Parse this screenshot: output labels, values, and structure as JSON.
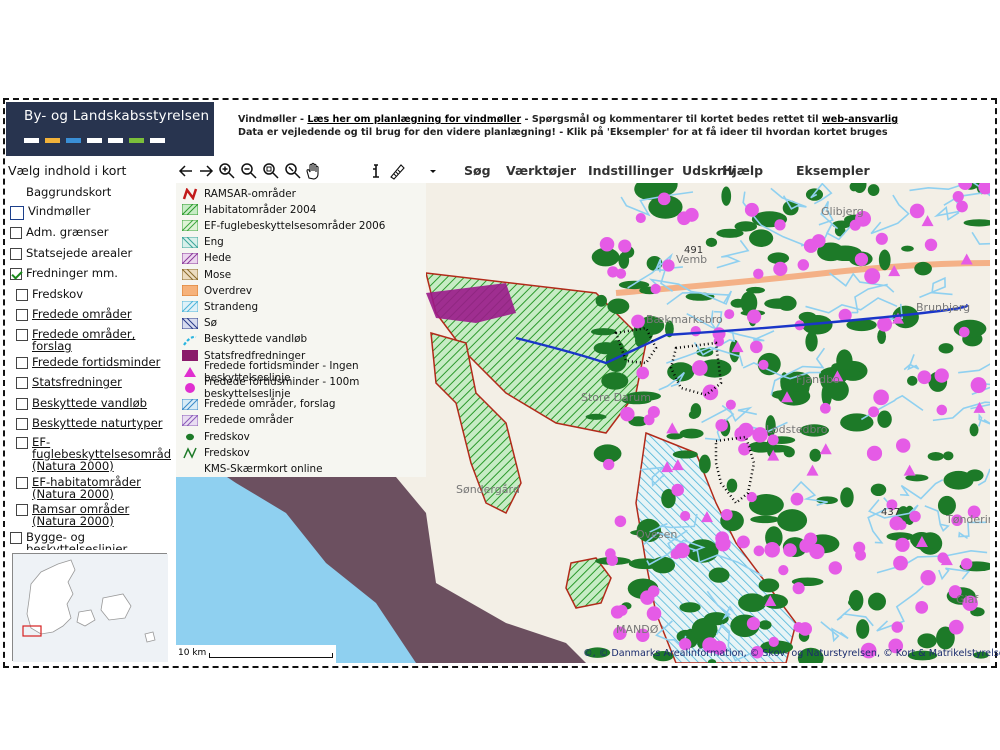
{
  "header": {
    "logo_text": "By- og Landskabsstyrelsen",
    "logo_bars": [
      "#ffffff",
      "#f2b23a",
      "#3a8fd6",
      "#ffffff",
      "#ffffff",
      "#7bbf3a",
      "#ffffff"
    ],
    "info_l1_a": "Vindmøller - ",
    "info_l1_link": "Læs her om planlægning for vindmøller",
    "info_l1_b": " - Spørgsmål og kommentarer til kortet bedes rettet til ",
    "info_l1_link2": "web-ansvarlig",
    "info_l2": "Data er vejledende og til brug for den videre planlægning! - Klik på 'Eksempler' for at få ideer til hvordan kortet bruges"
  },
  "sidebar": {
    "heading": "Vælg indhold i kort",
    "items": [
      {
        "label": "Baggrundskort",
        "checkbox": false
      },
      {
        "label": "Vindmøller",
        "checkbox": true,
        "checked": false,
        "big": true
      },
      {
        "label": "Adm. grænser",
        "checkbox": true,
        "checked": false
      },
      {
        "label": "Statsejede arealer",
        "checkbox": true,
        "checked": false
      },
      {
        "label": "Fredninger mm.",
        "checkbox": true,
        "checked": true
      },
      {
        "label": "Fredskov",
        "checkbox": true,
        "checked": false
      },
      {
        "label": "Fredede områder",
        "checkbox": true,
        "checked": false,
        "underline": true
      },
      {
        "label": "Fredede områder, forslag",
        "checkbox": true,
        "checked": false,
        "underline": true
      },
      {
        "label": "Fredede fortidsminder",
        "checkbox": true,
        "checked": false,
        "underline": true
      },
      {
        "label": "Statsfredninger",
        "checkbox": true,
        "checked": false,
        "underline": true
      },
      {
        "label": "Beskyttede vandløb",
        "checkbox": true,
        "checked": false,
        "underline": true
      },
      {
        "label": "Beskyttede naturtyper",
        "checkbox": true,
        "checked": false,
        "underline": true
      },
      {
        "label": "EF-fuglebeskyttelsesområder (Natura 2000)",
        "checkbox": true,
        "checked": false,
        "underline": true
      },
      {
        "label": "EF-habitatområder (Natura 2000)",
        "checkbox": true,
        "checked": false,
        "underline": true
      },
      {
        "label": "Ramsar områder (Natura 2000)",
        "checkbox": true,
        "checked": false,
        "underline": true
      },
      {
        "label": "Bygge- og beskyttelseslinjer",
        "checkbox": true,
        "checked": false
      }
    ]
  },
  "toolbar": {
    "menus": [
      "Søg",
      "Værktøjer",
      "Indstillinger",
      "Udskriv",
      "Hjælp",
      "Eksempler"
    ]
  },
  "legend": {
    "items": [
      {
        "label": "RAMSAR-områder",
        "type": "line-red"
      },
      {
        "label": "Habitatområder 2004",
        "type": "hatch-green"
      },
      {
        "label": "EF-fuglebeskyttelsesområder 2006",
        "type": "hatch-green2"
      },
      {
        "label": "Eng",
        "type": "hatch-teal"
      },
      {
        "label": "Hede",
        "type": "hatch-purple"
      },
      {
        "label": "Mose",
        "type": "hatch-brown"
      },
      {
        "label": "Overdrev",
        "type": "fill-orange"
      },
      {
        "label": "Strandeng",
        "type": "hatch-cyan"
      },
      {
        "label": "Sø",
        "type": "hatch-navy"
      },
      {
        "label": "Beskyttede vandløb",
        "type": "line-cyan"
      },
      {
        "label": "Statsfredfredninger",
        "type": "fill-maroon"
      },
      {
        "label": "Fredede fortidsminder - Ingen beskyttelseslinje",
        "type": "triangle-magenta"
      },
      {
        "label": "Fredede fortidsminder - 100m beskyttelseslinje",
        "type": "circle-magenta"
      },
      {
        "label": "Fredede områder, forslag",
        "type": "hatch-blue"
      },
      {
        "label": "Fredede områder",
        "type": "hatch-violet"
      },
      {
        "label": "Fredskov",
        "type": "dot-green"
      },
      {
        "label": "Fredskov",
        "type": "line-green"
      },
      {
        "label": "KMS-Skærmkort online",
        "type": "none"
      }
    ]
  },
  "map": {
    "place_labels": [
      "Glibjerg",
      "Vemb",
      "Bækmarksbro",
      "Brunbjerg",
      "Store Darum",
      "Fjandbo",
      "Lodstedbro",
      "Ovesen",
      "Tøndering",
      "Søndergård",
      "MANDØ",
      "Glaf"
    ],
    "road_labels": [
      "491",
      "437"
    ],
    "copyright": "©, © Danmarks Arealinformation, © Skov- og Naturstyrelsen, © Kort & Matrikelstyrelsen",
    "scale_label": "10 km",
    "colors": {
      "land": "#f3efe6",
      "sea": "#6c5060",
      "water": "#8fd0f0",
      "forest": "#1d7a28",
      "monument": "#e55be6",
      "wind_line": "#1a36c8",
      "ramsar": "#b22a1a"
    }
  }
}
